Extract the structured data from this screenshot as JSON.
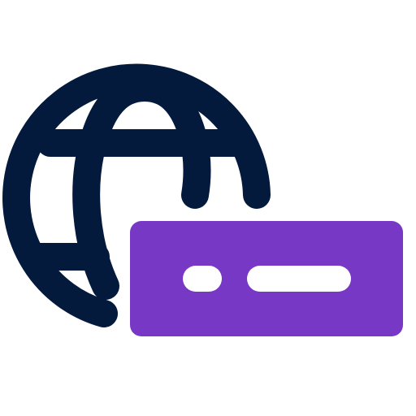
{
  "icon": {
    "name": "globe-domain-icon",
    "colors": {
      "globe": "#031a3c",
      "badge": "#7739c5",
      "badge_marks": "#ffffff",
      "background": "#ffffff"
    }
  }
}
